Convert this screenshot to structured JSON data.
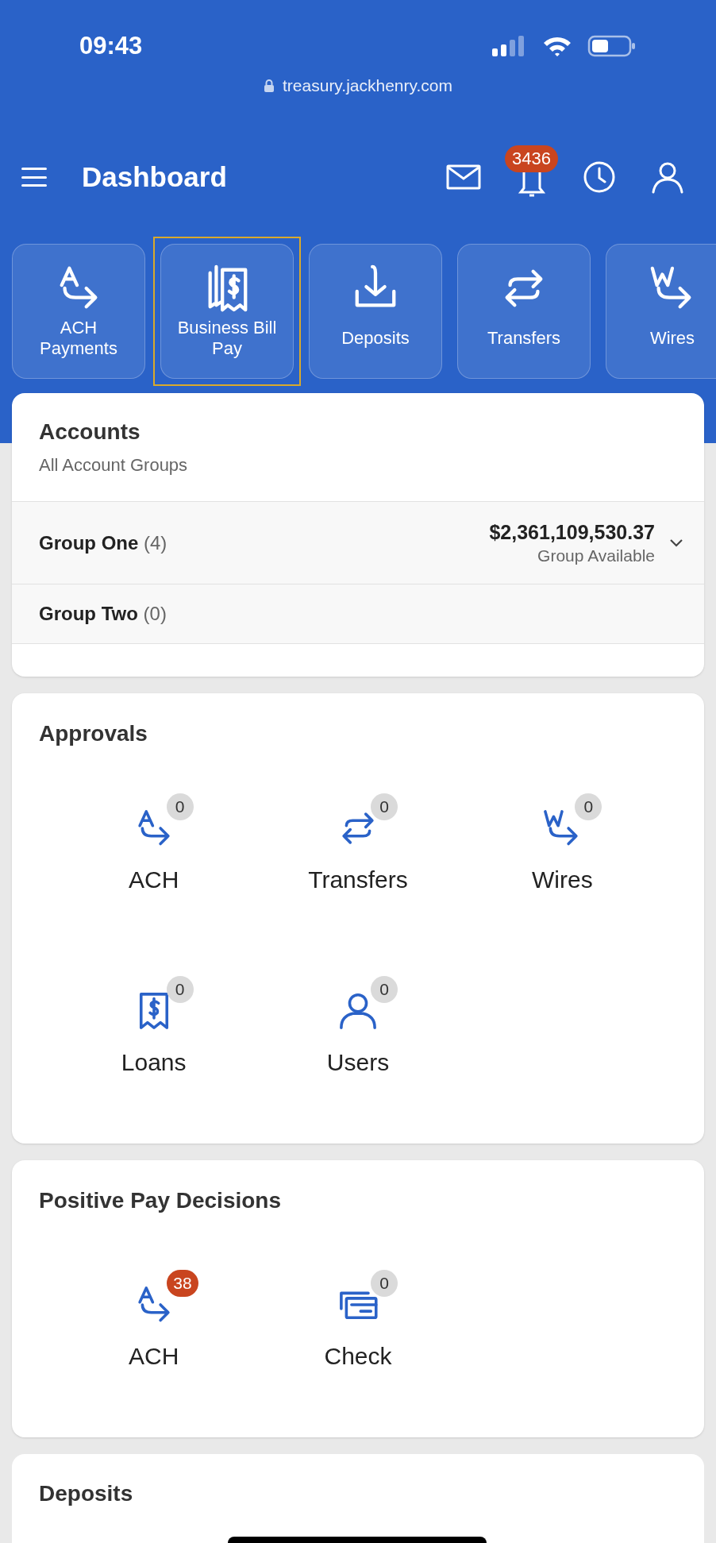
{
  "status_bar": {
    "time": "09:43",
    "url": "treasury.jackhenry.com"
  },
  "header": {
    "title": "Dashboard",
    "notification_count": "3436"
  },
  "quick_actions": [
    {
      "label": "ACH Payments",
      "kind": "ach",
      "selected": false
    },
    {
      "label": "Business Bill Pay",
      "kind": "bill",
      "selected": true
    },
    {
      "label": "Deposits",
      "kind": "deposit",
      "selected": false
    },
    {
      "label": "Transfers",
      "kind": "transfer",
      "selected": false
    },
    {
      "label": "Wires",
      "kind": "wire",
      "selected": false
    }
  ],
  "accounts": {
    "title": "Accounts",
    "subtitle": "All Account Groups",
    "groups": [
      {
        "name": "Group One",
        "count": "(4)",
        "amount": "$2,361,109,530.37",
        "amount_label": "Group Available"
      },
      {
        "name": "Group Two",
        "count": "(0)"
      }
    ]
  },
  "approvals": {
    "title": "Approvals",
    "items": [
      {
        "label": "ACH",
        "kind": "ach",
        "count": "0",
        "alert": false
      },
      {
        "label": "Transfers",
        "kind": "transfer",
        "count": "0",
        "alert": false
      },
      {
        "label": "Wires",
        "kind": "wire",
        "count": "0",
        "alert": false
      },
      {
        "label": "Loans",
        "kind": "loan",
        "count": "0",
        "alert": false
      },
      {
        "label": "Users",
        "kind": "user",
        "count": "0",
        "alert": false
      }
    ]
  },
  "positive_pay": {
    "title": "Positive Pay Decisions",
    "items": [
      {
        "label": "ACH",
        "kind": "ach",
        "count": "38",
        "alert": true
      },
      {
        "label": "Check",
        "kind": "check",
        "count": "0",
        "alert": false
      }
    ]
  },
  "deposits": {
    "title": "Deposits"
  }
}
